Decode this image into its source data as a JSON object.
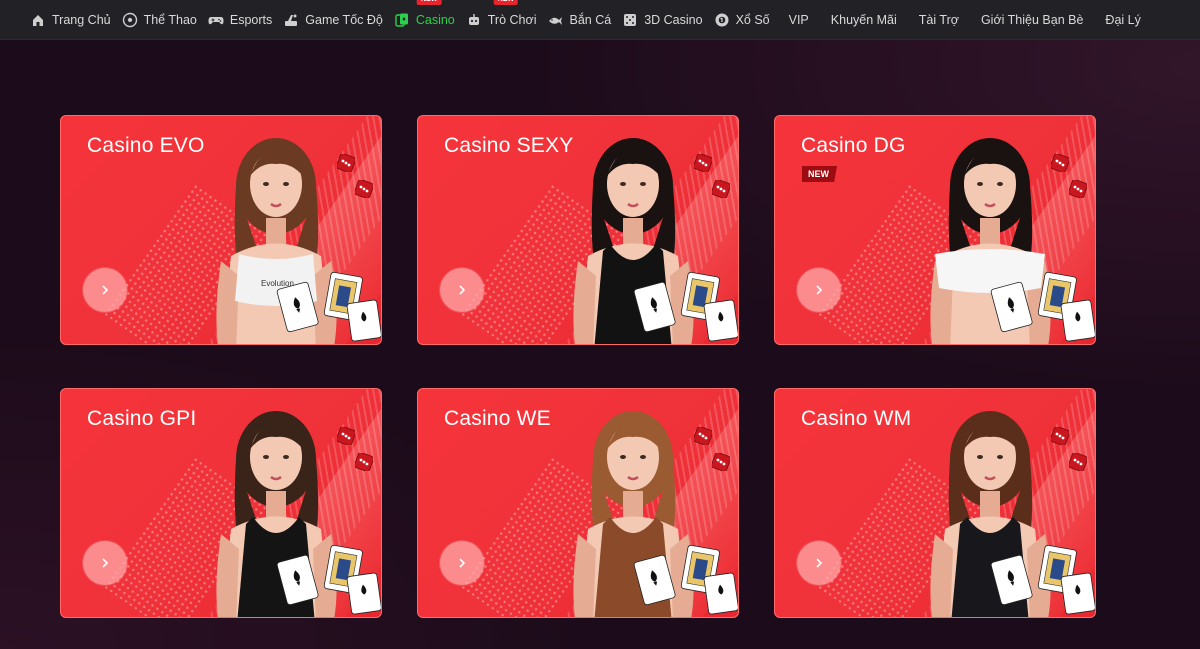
{
  "nav": {
    "items": [
      {
        "label": "Trang Chủ",
        "icon": "home-icon"
      },
      {
        "label": "Thể Thao",
        "icon": "soccer-ball-icon"
      },
      {
        "label": "Esports",
        "icon": "gamepad-icon"
      },
      {
        "label": "Game Tốc Độ",
        "icon": "speed-game-icon"
      },
      {
        "label": "Casino",
        "icon": "casino-chip-icon",
        "active": true,
        "tag": "NEW"
      },
      {
        "label": "Trò Chơi",
        "icon": "robot-icon",
        "tag": "NEW"
      },
      {
        "label": "Bắn Cá",
        "icon": "fish-icon"
      },
      {
        "label": "3D Casino",
        "icon": "dice-icon"
      },
      {
        "label": "Xổ Số",
        "icon": "lottery-ball-icon"
      },
      {
        "label": "VIP"
      },
      {
        "label": "Khuyến Mãi"
      },
      {
        "label": "Tài Trợ"
      },
      {
        "label": "Giới Thiệu Bạn Bè"
      },
      {
        "label": "Đại Lý"
      }
    ],
    "active_color": "#2bd14b",
    "tag_color": "#e8242e"
  },
  "casino_cards": [
    {
      "title": "Casino EVO",
      "top_label": "Evolution",
      "new": false,
      "outfit": "#f2f2f2",
      "hair": "#6b3a22"
    },
    {
      "title": "Casino SEXY",
      "new": false,
      "outfit": "#121212",
      "hair": "#1a1210"
    },
    {
      "title": "Casino DG",
      "new": true,
      "badge": "NEW",
      "outfit": "#f6f6f6",
      "hair": "#1a1210"
    },
    {
      "title": "Casino GPI",
      "new": false,
      "outfit": "#141414",
      "hair": "#3a2419"
    },
    {
      "title": "Casino WE",
      "new": false,
      "outfit": "#8b4a2a",
      "hair": "#9a5a32"
    },
    {
      "title": "Casino WM",
      "new": false,
      "outfit": "#18181c",
      "hair": "#5a2e1a"
    }
  ],
  "colors": {
    "card_red": "#f2323a",
    "page_bg": "#1c0b1a",
    "nav_bg": "#222125"
  }
}
